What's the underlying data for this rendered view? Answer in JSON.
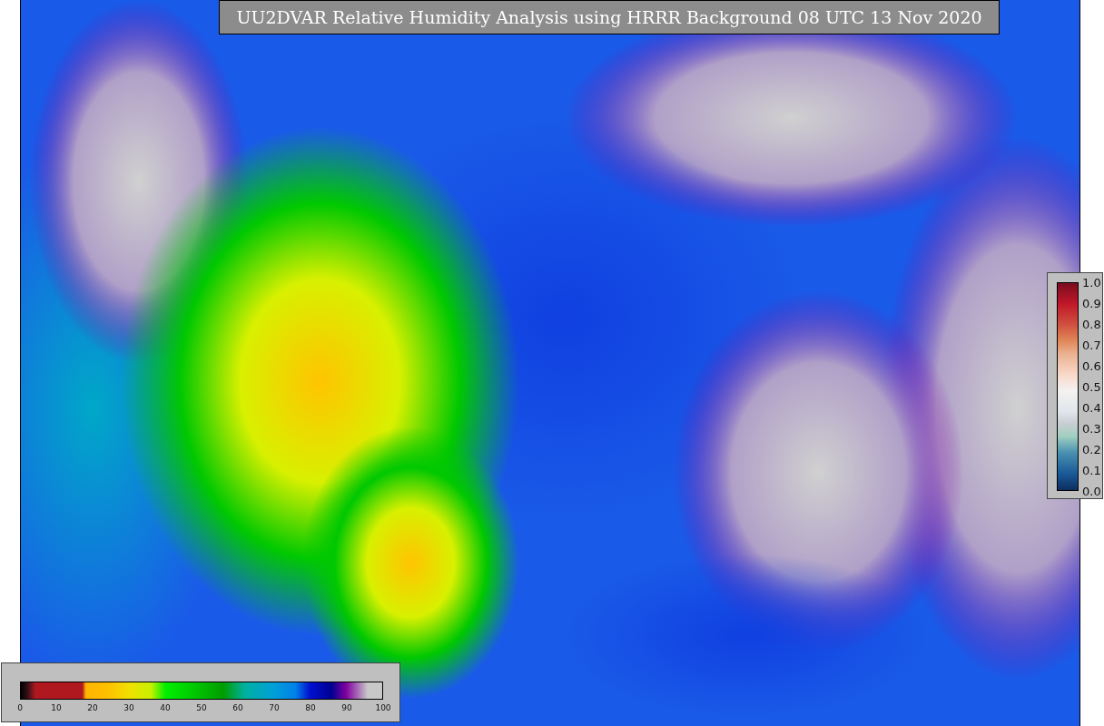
{
  "title": "UU2DVAR Relative Humidity Analysis using HRRR Background 08 UTC 13 Nov 2020",
  "humidity_colorbar": {
    "ticks": [
      "0",
      "10",
      "20",
      "30",
      "40",
      "50",
      "60",
      "70",
      "80",
      "90",
      "100"
    ]
  },
  "error_colorbar": {
    "ticks": [
      "1.0",
      "0.9",
      "0.8",
      "0.7",
      "0.6",
      "0.5",
      "0.4",
      "0.3",
      "0.2",
      "0.1",
      "0.0"
    ]
  }
}
